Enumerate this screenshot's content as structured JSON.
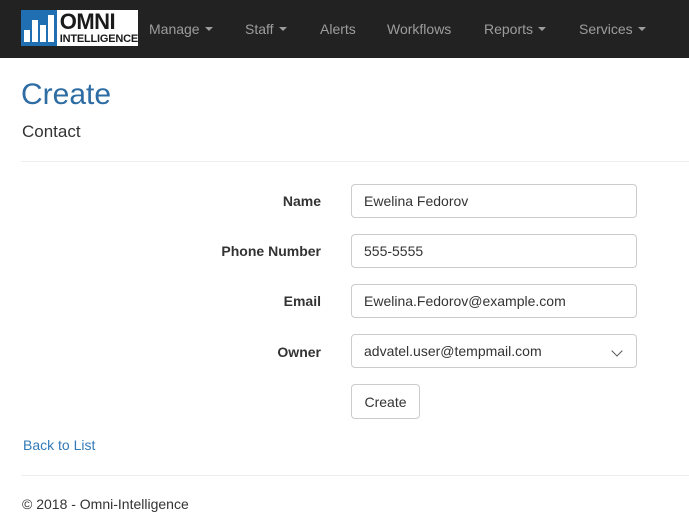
{
  "brand": {
    "line1": "OMNI",
    "line2": "INTELLIGENCE",
    "accent": "#1f6fb2"
  },
  "nav": {
    "items": [
      {
        "label": "Manage",
        "dropdown": true
      },
      {
        "label": "Staff",
        "dropdown": true
      },
      {
        "label": "Alerts",
        "dropdown": false
      },
      {
        "label": "Workflows",
        "dropdown": false
      },
      {
        "label": "Reports",
        "dropdown": true
      },
      {
        "label": "Services",
        "dropdown": true
      }
    ]
  },
  "page": {
    "title": "Create",
    "subtitle": "Contact",
    "title_color": "#2e6da4"
  },
  "form": {
    "name": {
      "label": "Name",
      "value": "Ewelina Fedorov"
    },
    "phone": {
      "label": "Phone Number",
      "value": "555-5555"
    },
    "email": {
      "label": "Email",
      "value": "Ewelina.Fedorov@example.com"
    },
    "owner": {
      "label": "Owner",
      "value": "advatel.user@tempmail.com"
    },
    "submit_label": "Create"
  },
  "links": {
    "back": "Back to List"
  },
  "footer": {
    "text": "© 2018 - Omni-Intelligence"
  }
}
